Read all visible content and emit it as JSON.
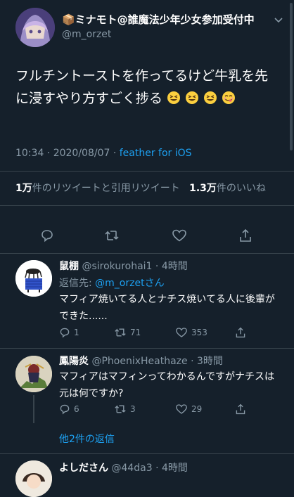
{
  "tweet": {
    "author_name": "📦ミナモト@誰魔法少年少女参加受付中",
    "author_handle": "@m_orzet",
    "text": "フルチントーストを作ってるけど牛乳を先に浸すやり方すごく捗る",
    "timestamp": "10:34 · 2020/08/07 · ",
    "client": "feather for iOS",
    "retweet_count": "1万",
    "retweet_label": "件のリツイートと引用リツイート",
    "like_count": "1.3万",
    "like_label": "件のいいね"
  },
  "replies": [
    {
      "name": "鼠棚",
      "handle_time": "@sirokurohai1 · 4時間",
      "reply_to_label": "返信先: ",
      "reply_to_handle": "@m_orzetさん",
      "text": "マフィア焼いてる人とナチス焼いてる人に後輩ができた......",
      "reply_count": "1",
      "retweet_count": "71",
      "like_count": "353"
    },
    {
      "name": "鳳陽炎",
      "handle_time": "@PhoenixHeathaze · 3時間",
      "text": "マフィアはマフィンってわかるんですがナチスは元は何ですか?",
      "reply_count": "6",
      "retweet_count": "3",
      "like_count": "29"
    },
    {
      "name": "よしださん",
      "handle_time": "@44da3 · 4時間"
    }
  ],
  "more_replies_label": "他2件の返信",
  "colors": {
    "background": "#15202b",
    "accent": "#1da1f2",
    "muted": "#8899a6",
    "divider": "#38444d"
  }
}
